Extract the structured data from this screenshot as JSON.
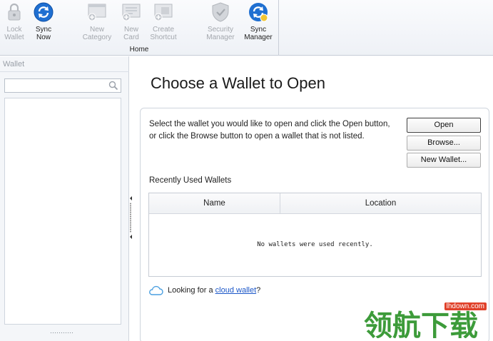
{
  "ribbon": {
    "buttons": [
      {
        "line1": "Lock",
        "line2": "Wallet",
        "icon": "lock-icon",
        "enabled": false
      },
      {
        "line1": "Sync",
        "line2": "Now",
        "icon": "sync-icon",
        "enabled": true
      },
      {
        "line1": "New",
        "line2": "Category",
        "icon": "new-category-icon",
        "enabled": false
      },
      {
        "line1": "New",
        "line2": "Card",
        "icon": "new-card-icon",
        "enabled": false
      },
      {
        "line1": "Create",
        "line2": "Shortcut",
        "icon": "create-shortcut-icon",
        "enabled": false
      },
      {
        "line1": "Security",
        "line2": "Manager",
        "icon": "shield-icon",
        "enabled": false
      },
      {
        "line1": "Sync",
        "line2": "Manager",
        "icon": "sync-manager-icon",
        "enabled": true
      }
    ],
    "group_label": "Home"
  },
  "sidebar": {
    "header": "Wallet",
    "search_placeholder": ""
  },
  "main": {
    "title": "Choose a Wallet to Open",
    "instructions": "Select the wallet you would like to open and click the Open button, or click the Browse button to open a wallet that is not listed.",
    "buttons": {
      "open": "Open",
      "browse": "Browse...",
      "new_wallet": "New Wallet..."
    },
    "recent_label": "Recently Used Wallets",
    "table": {
      "columns": [
        "Name",
        "Location"
      ],
      "empty_message": "No wallets were used recently."
    },
    "cloud": {
      "prefix": "Looking for a ",
      "link": "cloud wallet",
      "suffix": "?"
    }
  },
  "watermark": {
    "url": "lhdown.com",
    "text": "领航下载"
  },
  "colors": {
    "accent": "#1a56c8",
    "sync_blue": "#1f6fd1",
    "disabled_text": "#a3a7ad",
    "watermark_green": "#3d9b3a",
    "watermark_red": "#e0412a"
  }
}
